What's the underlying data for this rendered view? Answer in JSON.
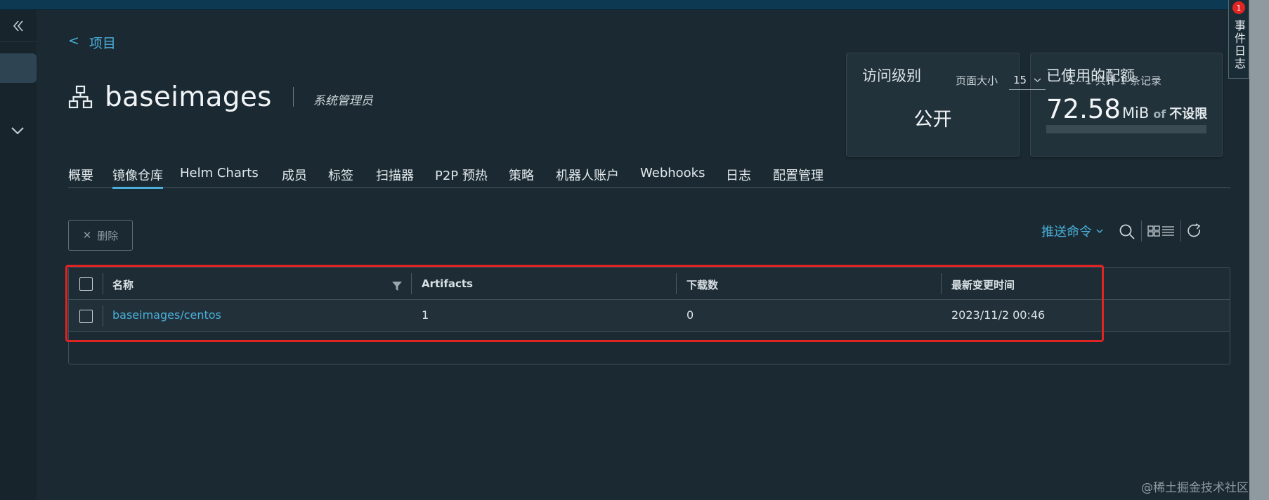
{
  "nav": {
    "back_label": "项目"
  },
  "project": {
    "name": "baseimages",
    "role": "系统管理员"
  },
  "cards": {
    "access": {
      "title": "访问级别",
      "value": "公开"
    },
    "quota": {
      "title": "已使用的配额",
      "value": "72.58",
      "unit": "MiB",
      "of": "of",
      "limit": "不设限",
      "usage_fraction": 0
    }
  },
  "events": {
    "label": "事件日志",
    "badge": "1"
  },
  "tabs": [
    {
      "label": "概要"
    },
    {
      "label": "镜像仓库"
    },
    {
      "label": "Helm Charts"
    },
    {
      "label": "成员"
    },
    {
      "label": "标签"
    },
    {
      "label": "扫描器"
    },
    {
      "label": "P2P 预热"
    },
    {
      "label": "策略"
    },
    {
      "label": "机器人账户"
    },
    {
      "label": "Webhooks"
    },
    {
      "label": "日志"
    },
    {
      "label": "配置管理"
    }
  ],
  "active_tab": "镜像仓库",
  "toolbar": {
    "delete_label": "删除",
    "push_command_label": "推送命令"
  },
  "table": {
    "columns": [
      "名称",
      "Artifacts",
      "下载数",
      "最新变更时间"
    ],
    "rows": [
      {
        "name": "baseimages/centos",
        "artifacts": "1",
        "pulls": "0",
        "updated": "2023/11/2 00:46"
      }
    ]
  },
  "pagination": {
    "page_size_label": "页面大小",
    "page_size": "15",
    "summary": "1 - 1 共计 1 条记录"
  },
  "watermark": "@稀土掘金技术社区",
  "colors": {
    "accent": "#4aaed9",
    "highlight": "#e02424",
    "background": "#1b2a32"
  }
}
